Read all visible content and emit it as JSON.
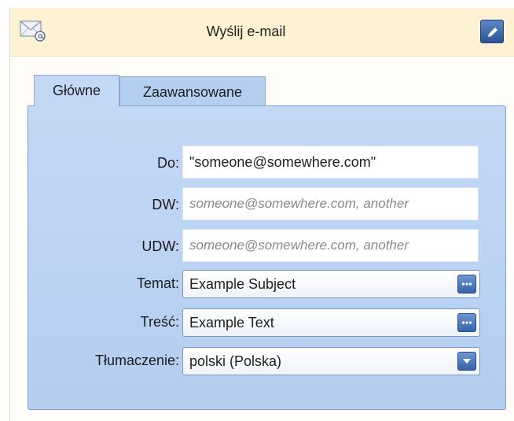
{
  "activity": {
    "title": "Wyślij e-mail",
    "icons": {
      "header": "mail-icon",
      "edit": "pencil-icon"
    }
  },
  "tabs": [
    {
      "label": "Główne",
      "active": true
    },
    {
      "label": "Zaawansowane",
      "active": false
    }
  ],
  "form": {
    "to": {
      "label": "Do:",
      "value": "\"someone@somewhere.com\""
    },
    "cc": {
      "label": "DW:",
      "placeholder": "someone@somewhere.com, another"
    },
    "bcc": {
      "label": "UDW:",
      "placeholder": "someone@somewhere.com, another"
    },
    "subject": {
      "label": "Temat:",
      "value": "Example Subject",
      "button_icon": "ellipsis-icon"
    },
    "body": {
      "label": "Treść:",
      "value": "Example Text",
      "button_icon": "ellipsis-icon"
    },
    "translation": {
      "label": "Tłumaczenie:",
      "value": "polski (Polska)",
      "button_icon": "dropdown-arrow-icon"
    }
  },
  "colors": {
    "header_bg": "#fdf2d3",
    "panel_bg": "#c3d8f5",
    "button_blue": "#3663a8"
  }
}
